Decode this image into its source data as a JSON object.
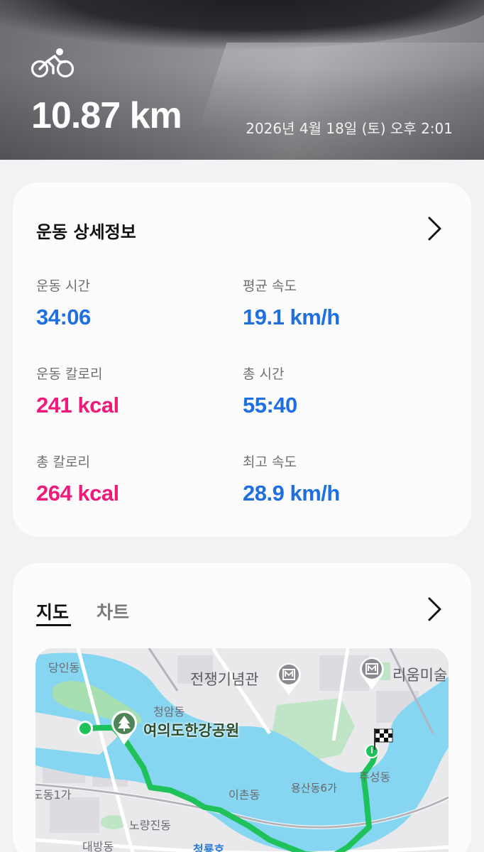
{
  "header": {
    "activity_icon": "cycling-icon",
    "distance": "10.87 km",
    "datetime": "2026년 4월 18일 (토) 오후 2:01"
  },
  "details": {
    "title": "운동 상세정보",
    "chevron_icon": "chevron-right-icon",
    "stats": [
      {
        "label": "운동 시간",
        "value": "34:06",
        "color": "#1f6fe0"
      },
      {
        "label": "평균 속도",
        "value": "19.1 km/h",
        "color": "#1f6fe0"
      },
      {
        "label": "운동 칼로리",
        "value": "241 kcal",
        "color": "#f0197c"
      },
      {
        "label": "총 시간",
        "value": "55:40",
        "color": "#1f6fe0"
      },
      {
        "label": "총 칼로리",
        "value": "264 kcal",
        "color": "#f0197c"
      },
      {
        "label": "최고 속도",
        "value": "28.9 km/h",
        "color": "#1f6fe0"
      }
    ]
  },
  "map_card": {
    "tabs": [
      {
        "label": "지도",
        "selected": true
      },
      {
        "label": "차트",
        "selected": false
      }
    ],
    "chevron_icon": "chevron-right-icon",
    "map": {
      "labels": {
        "dangin": "당인동",
        "war_memorial": "전쟁기념관",
        "leeum": "리움미술",
        "cheongam": "청암동",
        "yeouido_park": "여의도한강공원",
        "ichon": "이촌동",
        "yongsan6": "용산동6가",
        "juseong": "주성동",
        "dong1ga": "도동1가",
        "noryangjin": "노량진동",
        "daebang": "대방동",
        "cheongryong": "청룡호"
      },
      "route_color": "#1fc25a",
      "water_color": "#86d6f2",
      "start_icon": "start-marker-icon",
      "finish_icon": "checkered-flag-icon",
      "park_icon": "park-tree-icon",
      "museum_icon": "museum-icon"
    }
  }
}
